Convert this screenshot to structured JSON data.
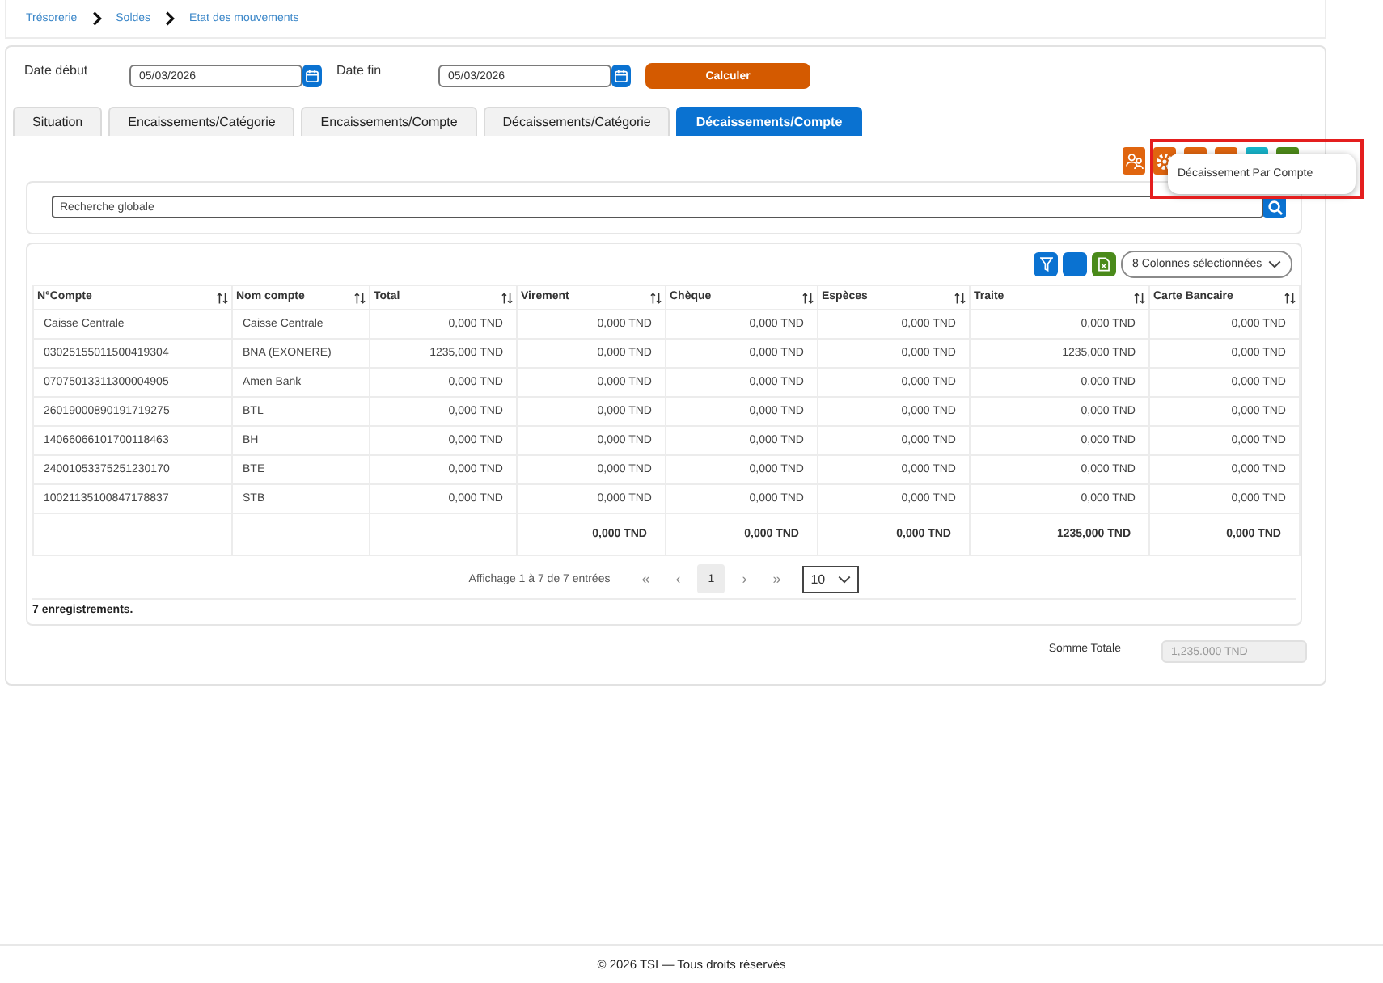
{
  "breadcrumb": [
    {
      "label": "Trésorerie"
    },
    {
      "label": "Soldes"
    },
    {
      "label": "Etat des mouvements"
    }
  ],
  "filters": {
    "start_date": {
      "label": "Date début",
      "value": "05/03/2026"
    },
    "end_date": {
      "label": "Date fin",
      "value": "05/03/2026"
    },
    "calculate_button": "Calculer"
  },
  "tabs": [
    {
      "label": "Situation",
      "selected": false
    },
    {
      "label": "Encaissements/Catégorie",
      "selected": false
    },
    {
      "label": "Encaissements/Compte",
      "selected": false
    },
    {
      "label": "Décaissements/Catégorie",
      "selected": false
    },
    {
      "label": "Décaissements/Compte",
      "selected": true
    }
  ],
  "export_toolbar": {
    "buttons": [
      {
        "kind": "people",
        "color": "#e0650f"
      },
      {
        "kind": "gear",
        "color": "#e0650f"
      },
      {
        "kind": "plain",
        "color": "#e0650f"
      },
      {
        "kind": "plain",
        "color": "#e0650f"
      },
      {
        "kind": "plain",
        "color": "#17b3c9"
      },
      {
        "kind": "plain",
        "color": "#4d8a1a"
      }
    ],
    "tooltip": {
      "text": "Décaissement Par Compte",
      "highlighted": true
    }
  },
  "search": {
    "placeholder": "Recherche globale"
  },
  "table": {
    "toolbar": {
      "buttons": [
        {
          "kind": "filter",
          "color": "#0a72d1"
        },
        {
          "kind": "plain",
          "color": "#0a72d1"
        },
        {
          "kind": "document",
          "color": "#4a8a1a"
        }
      ],
      "column_picker": "8 Colonnes sélectionnées"
    },
    "columns": [
      "N°Compte",
      "Nom compte",
      "Total",
      "Virement",
      "Chèque",
      "Espèces",
      "Traite",
      "Carte Bancaire"
    ],
    "rows": [
      [
        "Caisse Centrale",
        "Caisse Centrale",
        "0,000 TND",
        "0,000 TND",
        "0,000 TND",
        "0,000 TND",
        "0,000 TND",
        "0,000 TND"
      ],
      [
        "03025155011500419304",
        "BNA (EXONERE)",
        "1235,000 TND",
        "0,000 TND",
        "0,000 TND",
        "0,000 TND",
        "1235,000 TND",
        "0,000 TND"
      ],
      [
        "07075013311300004905",
        "Amen Bank",
        "0,000 TND",
        "0,000 TND",
        "0,000 TND",
        "0,000 TND",
        "0,000 TND",
        "0,000 TND"
      ],
      [
        "26019000890191719275",
        "BTL",
        "0,000 TND",
        "0,000 TND",
        "0,000 TND",
        "0,000 TND",
        "0,000 TND",
        "0,000 TND"
      ],
      [
        "14066066101700118463",
        "BH",
        "0,000 TND",
        "0,000 TND",
        "0,000 TND",
        "0,000 TND",
        "0,000 TND",
        "0,000 TND"
      ],
      [
        "24001053375251230170",
        "BTE",
        "0,000 TND",
        "0,000 TND",
        "0,000 TND",
        "0,000 TND",
        "0,000 TND",
        "0,000 TND"
      ],
      [
        "10021135100847178837",
        "STB",
        "0,000 TND",
        "0,000 TND",
        "0,000 TND",
        "0,000 TND",
        "0,000 TND",
        "0,000 TND"
      ]
    ],
    "totals": [
      "0,000 TND",
      "0,000 TND",
      "0,000 TND",
      "1235,000 TND",
      "0,000 TND"
    ],
    "pagination": {
      "summary": "Affichage 1 à 7 de 7 entrées",
      "first": "«",
      "previous": "‹",
      "pages": [
        {
          "label": "1",
          "selected": true
        }
      ],
      "next": "›",
      "last": "»",
      "page_size": "10"
    },
    "record_count": "7 enregistrements."
  },
  "grand_total": {
    "label": "Somme Totale",
    "value": "1,235.000 TND",
    "disabled": true
  },
  "footer": "© 2026 TSI — Tous droits réservés"
}
